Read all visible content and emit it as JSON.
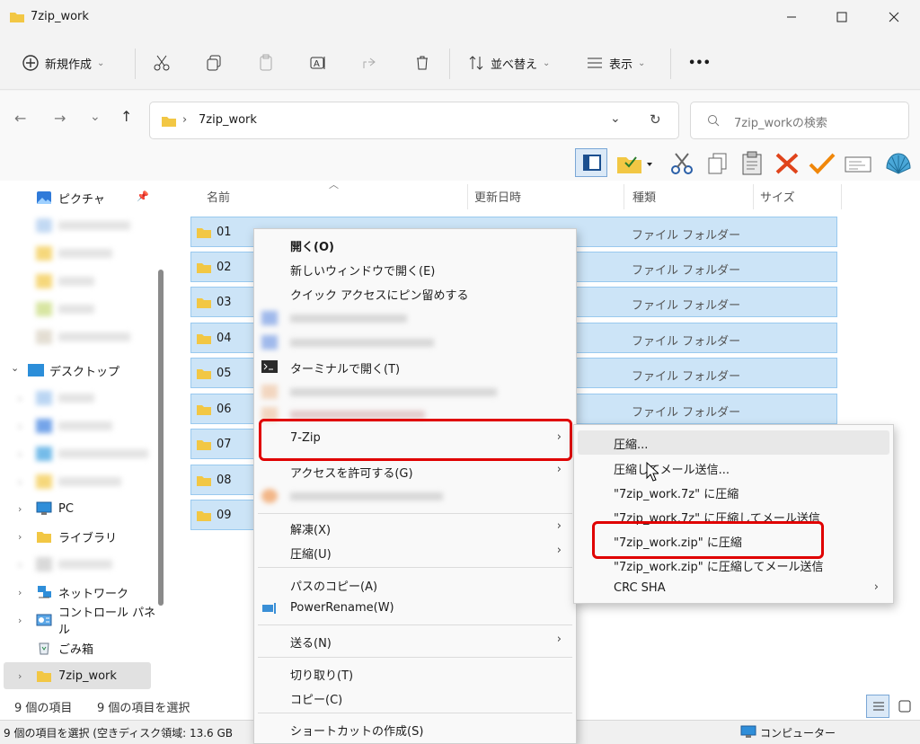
{
  "window": {
    "title": "7zip_work"
  },
  "cmdbar": {
    "new_label": "新規作成",
    "sort_label": "並べ替え",
    "view_label": "表示",
    "more_label": "•••"
  },
  "address": {
    "breadcrumb": "7zip_work",
    "search_placeholder": "7zip_workの検索"
  },
  "nav": {
    "items": [
      {
        "label": "ピクチャ"
      },
      {
        "label": "デスクトップ"
      },
      {
        "label": "PC"
      },
      {
        "label": "ライブラリ"
      },
      {
        "label": "ネットワーク"
      },
      {
        "label": "コントロール パネル"
      },
      {
        "label": "ごみ箱"
      },
      {
        "label": "7zip_work"
      }
    ]
  },
  "columns": {
    "name": "名前",
    "date": "更新日時",
    "type": "種類",
    "size": "サイズ"
  },
  "files": [
    {
      "name": "01",
      "type": "ファイル フォルダー"
    },
    {
      "name": "02",
      "type": "ファイル フォルダー"
    },
    {
      "name": "03",
      "type": "ファイル フォルダー"
    },
    {
      "name": "04",
      "type": "ファイル フォルダー"
    },
    {
      "name": "05",
      "type": "ファイル フォルダー"
    },
    {
      "name": "06",
      "type": "ファイル フォルダー"
    },
    {
      "name": "07",
      "type": ""
    },
    {
      "name": "08",
      "type": ""
    },
    {
      "name": "09",
      "type": ""
    }
  ],
  "status": {
    "item_count": "9 個の項目",
    "selected": "9 個の項目を選択",
    "bottom": "9 個の項目を選択 (空きディスク領域: 13.6 GB",
    "computer": "コンピューター"
  },
  "context_menu": {
    "open": "開く(O)",
    "open_new_window": "新しいウィンドウで開く(E)",
    "pin_quick": "クイック アクセスにピン留めする",
    "terminal": "ターミナルで開く(T)",
    "sevenzip": "7-Zip",
    "grant_access": "アクセスを許可する(G)",
    "extract": "解凍(X)",
    "compress": "圧縮(U)",
    "copy_path": "パスのコピー(A)",
    "powerrename": "PowerRename(W)",
    "send_to": "送る(N)",
    "cut": "切り取り(T)",
    "copy": "コピー(C)",
    "create_shortcut": "ショートカットの作成(S)"
  },
  "submenu": {
    "compress": "圧縮...",
    "compress_email": "圧縮してメール送信...",
    "compress_7z": "\"7zip_work.7z\" に圧縮",
    "compress_7z_email": "\"7zip_work.7z\" に圧縮してメール送信",
    "compress_zip": "\"7zip_work.zip\" に圧縮",
    "compress_zip_email": "\"7zip_work.zip\" に圧縮してメール送信",
    "crc_sha": "CRC SHA"
  },
  "colors": {
    "selection": "#cce4f7",
    "highlight": "#e00000",
    "folder": "#f2c744"
  }
}
